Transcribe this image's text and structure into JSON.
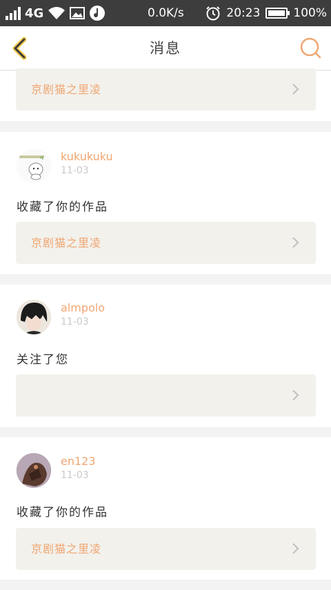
{
  "status_bar": {
    "network": "4G",
    "speed": "0.0K/s",
    "time": "20:23",
    "battery": "100%",
    "icons": [
      "signal-icon",
      "wifi-icon",
      "image-icon",
      "music-icon",
      "alarm-icon",
      "battery-icon"
    ]
  },
  "header": {
    "title": "消息",
    "back_icon": "chevron-left-icon",
    "search_icon": "search-icon"
  },
  "messages": [
    {
      "user": "",
      "date": "",
      "action": "",
      "work_title": "京剧猫之里凌"
    },
    {
      "user": "kukukuku",
      "date": "11-03",
      "action": "收藏了你的作品",
      "work_title": "京剧猫之里凌"
    },
    {
      "user": "almpolo",
      "date": "11-03",
      "action": "关注了您",
      "work_title": ""
    },
    {
      "user": "en123",
      "date": "11-03",
      "action": "收藏了你的作品",
      "work_title": "京剧猫之里凌"
    }
  ],
  "colors": {
    "accent": "#f0a672",
    "status_bar": "#3d3d3d",
    "box": "#f2f1ec"
  }
}
